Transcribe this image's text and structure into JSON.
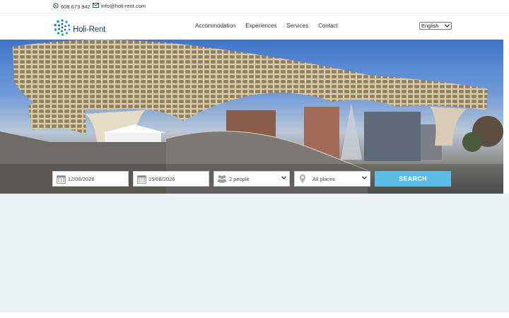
{
  "topbar": {
    "phone_icon": "whatsapp-icon",
    "phone": "608 673 942",
    "email_icon": "envelope-icon",
    "email": "info@holi-rent.com"
  },
  "header": {
    "logo_text": "Holi-Rent",
    "nav": [
      "Accommodation",
      "Experiences",
      "Services",
      "Contact"
    ],
    "language": "English"
  },
  "search": {
    "checkin": "12/08/2026",
    "checkout": "15/08/2026",
    "guests": "2 people",
    "place": "All places",
    "button": "SEARCH",
    "icons": [
      "calendar-icon",
      "calendar-icon",
      "people-icon",
      "map-pin-icon"
    ]
  },
  "colors": {
    "accent": "#5bbde6",
    "content_bg": "#eaf2f5",
    "text": "#333333"
  }
}
